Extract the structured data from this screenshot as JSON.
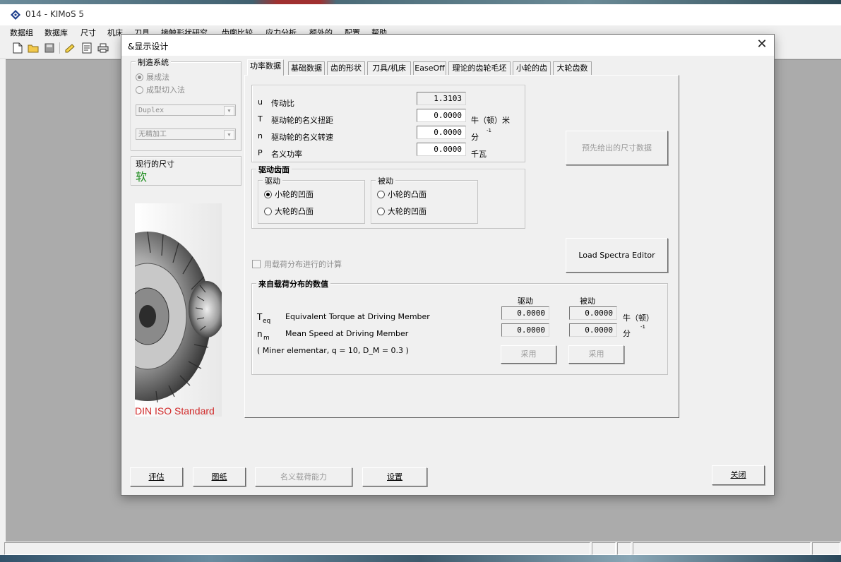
{
  "app": {
    "title": "014 - KIMoS 5"
  },
  "menu": [
    "数据组",
    "数据库",
    "尺寸",
    "机床",
    "刀具",
    "接触形状研究",
    "齿廓比较",
    "应力分析",
    "额外的",
    "配置",
    "帮助"
  ],
  "dialog": {
    "title": "&显示设计",
    "manufacturing": {
      "label": "制造系统",
      "option1": "展成法",
      "option2": "成型切入法",
      "combo1": "Duplex",
      "combo2": "无精加工"
    },
    "current_size": {
      "label": "现行的尺寸",
      "value": "软"
    },
    "image_caption": "DIN ISO Standard",
    "tabs": [
      "功率数据",
      "基础数据",
      "齿的形状",
      "刀具/机床",
      "EaseOff",
      "理论的齿轮毛坯",
      "小轮的齿",
      "大轮齿数"
    ],
    "power": {
      "u_sym": "u",
      "u_label": "传动比",
      "u_value": "1.3103",
      "t_sym": "T",
      "t_label": "驱动轮的名义扭距",
      "t_value": "0.0000",
      "t_unit": "牛（顿）米",
      "n_sym": "n",
      "n_label": "驱动轮的名义转速",
      "n_value": "0.0000",
      "n_unit": "分",
      "n_exp": "-1",
      "p_sym": "P",
      "p_label": "名义功率",
      "p_value": "0.0000",
      "p_unit": "千瓦"
    },
    "drive_flank": {
      "label": "驱动齿面",
      "drive_label": "驱动",
      "drive_opt1": "小轮的凹面",
      "drive_opt2": "大轮的凸面",
      "coast_label": "被动",
      "coast_opt1": "小轮的凸面",
      "coast_opt2": "大轮的凹面"
    },
    "btn_preselect": "预先给出的尺寸数据",
    "btn_load_spectra": "Load Spectra Editor",
    "load_dist_check": "用载荷分布进行的计算",
    "load_dist": {
      "label": "来自载荷分布的数值",
      "col_drive": "驱动",
      "col_coast": "被动",
      "teq_sym": "T",
      "teq_sub": "eq",
      "teq_label": "Equivalent Torque at Driving Member",
      "teq_drive": "0.0000",
      "teq_coast": "0.0000",
      "teq_unit": "牛（顿）",
      "nm_sym": "n",
      "nm_sub": "m",
      "nm_label": "Mean Speed at Driving Member",
      "nm_drive": "0.0000",
      "nm_coast": "0.0000",
      "nm_unit": "分",
      "nm_exp": "-1",
      "note": "( Miner elementar,  q = 10,  D_M = 0.3 )",
      "apply1": "采用",
      "apply2": "采用"
    },
    "bottom_buttons": {
      "evaluate": "评估",
      "drawing": "图纸",
      "nominal_load": "名义载荷能力",
      "settings": "设置",
      "close": "关闭"
    }
  }
}
